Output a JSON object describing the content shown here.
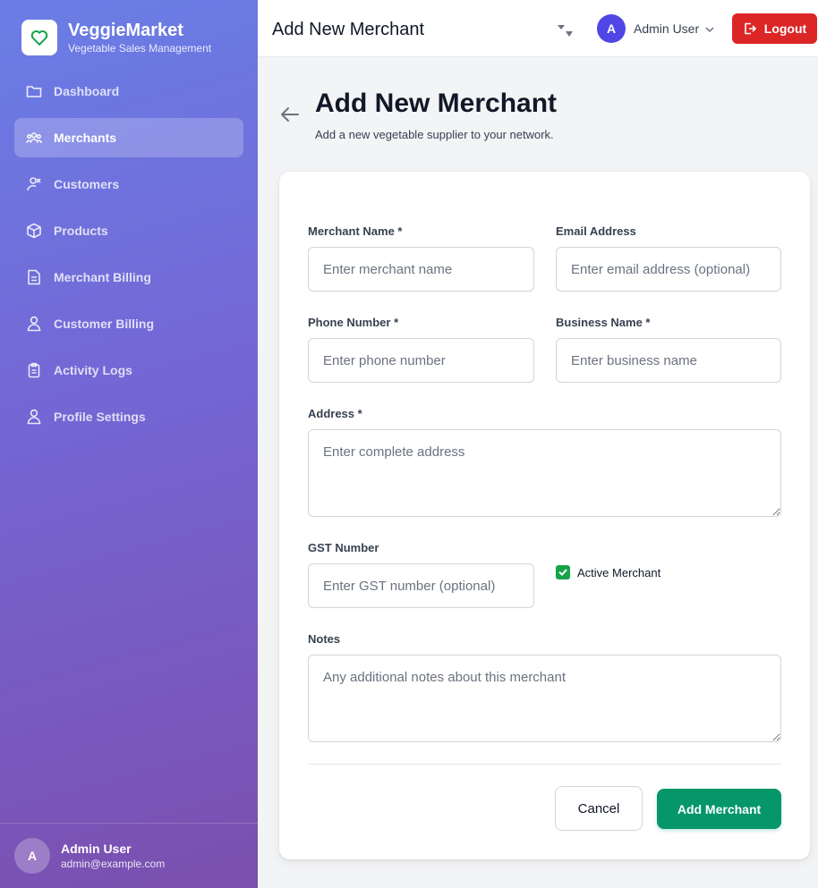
{
  "brand": {
    "title": "VeggieMarket",
    "subtitle": "Vegetable Sales Management",
    "logo_icon": "heart-icon",
    "accent": "#16a34a"
  },
  "sidebar": {
    "items": [
      {
        "label": "Dashboard",
        "icon": "folder-icon",
        "active": false
      },
      {
        "label": "Merchants",
        "icon": "users-group-icon",
        "active": true
      },
      {
        "label": "Customers",
        "icon": "customers-icon",
        "active": false
      },
      {
        "label": "Products",
        "icon": "cube-icon",
        "active": false
      },
      {
        "label": "Merchant Billing",
        "icon": "document-icon",
        "active": false
      },
      {
        "label": "Customer Billing",
        "icon": "user-icon",
        "active": false
      },
      {
        "label": "Activity Logs",
        "icon": "clipboard-icon",
        "active": false
      },
      {
        "label": "Profile Settings",
        "icon": "user-icon",
        "active": false
      }
    ],
    "user": {
      "initial": "A",
      "name": "Admin User",
      "email": "admin@example.com"
    }
  },
  "header": {
    "title": "Add New Merchant",
    "user_initial": "A",
    "user_name": "Admin User",
    "logout_label": "Logout",
    "logout_color": "#dc2626"
  },
  "page": {
    "title": "Add New Merchant",
    "subtitle": "Add a new vegetable supplier to your network."
  },
  "form": {
    "merchant_name": {
      "label": "Merchant Name *",
      "placeholder": "Enter merchant name",
      "value": ""
    },
    "email": {
      "label": "Email Address",
      "placeholder": "Enter email address (optional)",
      "value": ""
    },
    "phone": {
      "label": "Phone Number *",
      "placeholder": "Enter phone number",
      "value": ""
    },
    "business_name": {
      "label": "Business Name *",
      "placeholder": "Enter business name",
      "value": ""
    },
    "address": {
      "label": "Address *",
      "placeholder": "Enter complete address",
      "value": ""
    },
    "gst": {
      "label": "GST Number",
      "placeholder": "Enter GST number (optional)",
      "value": ""
    },
    "active": {
      "label": "Active Merchant",
      "checked": true
    },
    "notes": {
      "label": "Notes",
      "placeholder": "Any additional notes about this merchant",
      "value": ""
    },
    "cancel_label": "Cancel",
    "submit_label": "Add Merchant",
    "submit_color": "#059669"
  }
}
